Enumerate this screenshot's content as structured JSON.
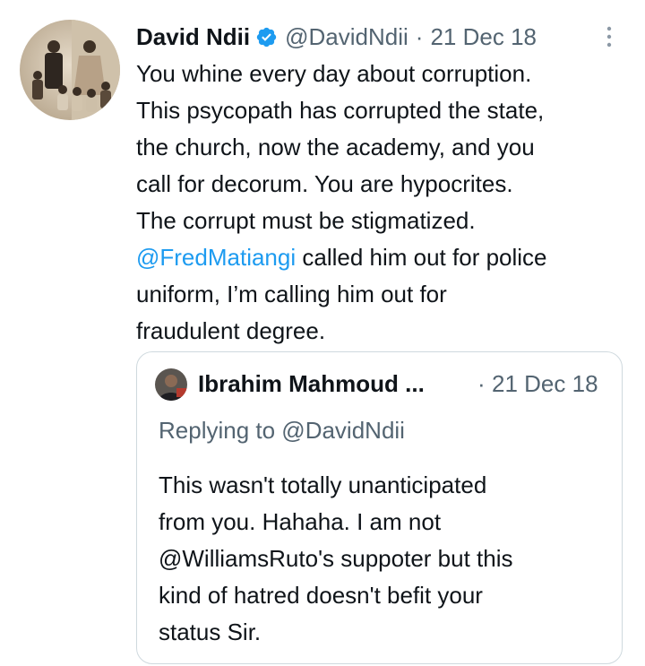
{
  "tweet": {
    "author_name": "David Ndii",
    "author_handle": "@DavidNdii",
    "separator": "·",
    "date": "21 Dec 18",
    "verified_icon": "verified-badge-icon",
    "more_icon": "more-options-icon",
    "text_lines": [
      "You whine every day about corruption.",
      "This psycopath has corrupted the state,",
      "the church, now the academy, and you",
      "call for decorum. You are hypocrites.",
      "The corrupt must be stigmatized."
    ],
    "mention": "@FredMatiangi",
    "text_after_mention": " called him out for police",
    "text_tail_lines": [
      "uniform, I’m calling him out for",
      "fraudulent degree."
    ]
  },
  "quoted_tweet": {
    "author_name": "Ibrahim Mahmoud ...",
    "separator": "·",
    "date": "21 Dec 18",
    "replying_to": "Replying to @DavidNdii",
    "text_lines": [
      "This wasn't totally unanticipated",
      "from you. Hahaha. I am not",
      "@WilliamsRuto's suppoter but this",
      "kind of hatred doesn't befit your",
      "status Sir."
    ]
  },
  "colors": {
    "link": "#1d9bf0",
    "secondary_text": "#536471",
    "primary_text": "#0f1419",
    "border": "#cfd9de",
    "verified": "#1d9bf0"
  }
}
